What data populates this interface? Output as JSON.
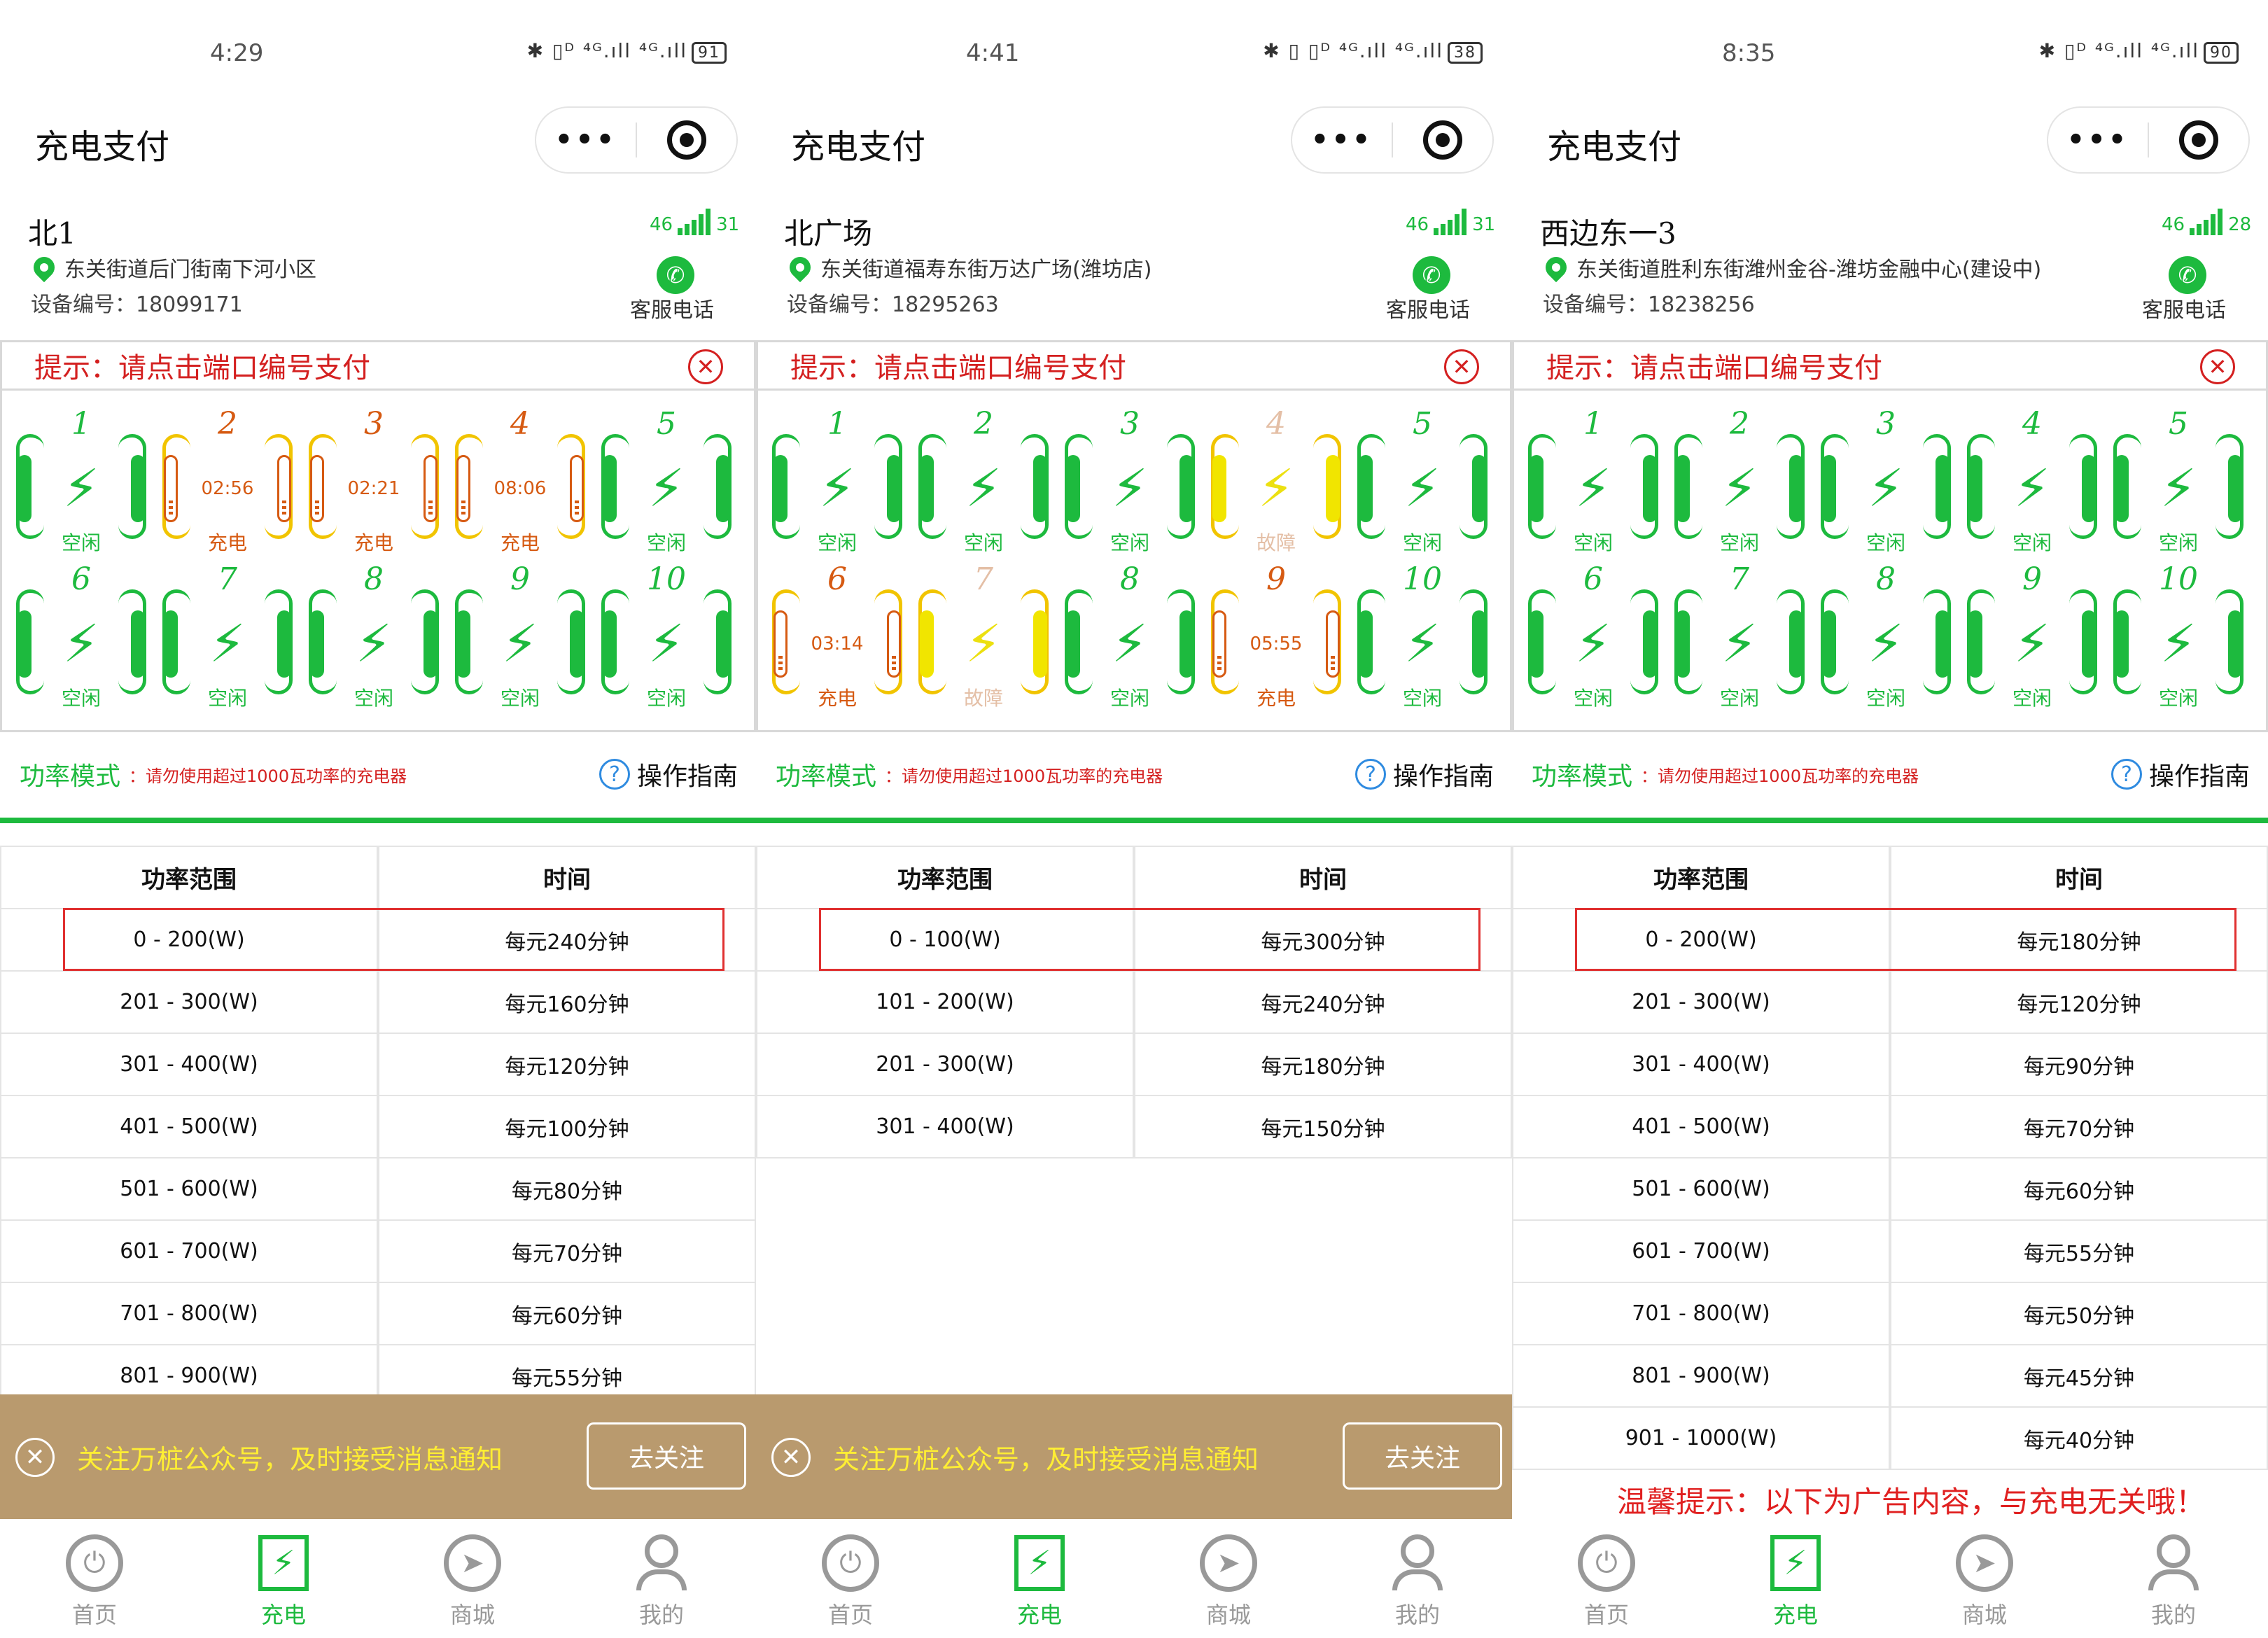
{
  "colors": {
    "accent": "#1dba3e",
    "hint": "#d42020",
    "charging": "#d65a12",
    "fault": "#f1e500",
    "follow_bar": "#b99a6e"
  },
  "icons": {
    "pin": "location-pin-icon",
    "phone": "phone-icon",
    "close": "close-circle-icon",
    "help": "question-circle-icon",
    "bolt": "lightning-bolt-icon"
  },
  "common": {
    "app_title": "充电支付",
    "capsule_more": "•••",
    "service": "客服电话",
    "hint": "提示：请点击端口编号支付",
    "power_label": "功率模式",
    "power_sub": "：请勿使用超过1000瓦功率的充电器",
    "guide": "操作指南",
    "col_range": "功率范围",
    "col_time": "时间",
    "follow_text": "关注万桩公众号，及时接受消息通知",
    "follow_btn": "去关注",
    "ad_note": "温馨提示：以下为广告内容，与充电无关哦！",
    "tabs": [
      "首页",
      "充电",
      "商城",
      "我的"
    ]
  },
  "panels": [
    {
      "status": {
        "time": "4:29",
        "net": "✱ ▯ᴰ ⁴ᴳ.ıll ⁴ᴳ.ıll",
        "battery": "91"
      },
      "station": {
        "name": "北1",
        "address": "东关街道后门街南下河小区",
        "device": "设备编号：18099171",
        "signal": "46",
        "signal_num": "31"
      },
      "ports": [
        {
          "n": "1",
          "state": "idle",
          "label": "空闲",
          "time": ""
        },
        {
          "n": "2",
          "state": "charging",
          "label": "充电",
          "time": "02:56"
        },
        {
          "n": "3",
          "state": "charging",
          "label": "充电",
          "time": "02:21"
        },
        {
          "n": "4",
          "state": "charging",
          "label": "充电",
          "time": "08:06"
        },
        {
          "n": "5",
          "state": "idle",
          "label": "空闲",
          "time": ""
        },
        {
          "n": "6",
          "state": "idle",
          "label": "空闲",
          "time": ""
        },
        {
          "n": "7",
          "state": "idle",
          "label": "空闲",
          "time": ""
        },
        {
          "n": "8",
          "state": "idle",
          "label": "空闲",
          "time": ""
        },
        {
          "n": "9",
          "state": "idle",
          "label": "空闲",
          "time": ""
        },
        {
          "n": "10",
          "state": "idle",
          "label": "空闲",
          "time": ""
        }
      ],
      "rates": [
        [
          "0 - 200(W)",
          "每元240分钟"
        ],
        [
          "201 - 300(W)",
          "每元160分钟"
        ],
        [
          "301 - 400(W)",
          "每元120分钟"
        ],
        [
          "401 - 500(W)",
          "每元100分钟"
        ],
        [
          "501 - 600(W)",
          "每元80分钟"
        ],
        [
          "601 - 700(W)",
          "每元70分钟"
        ],
        [
          "701 - 800(W)",
          "每元60分钟"
        ],
        [
          "801 - 900(W)",
          "每元55分钟"
        ]
      ],
      "follow": true,
      "ad": false
    },
    {
      "status": {
        "time": "4:41",
        "net": "✱ ▯ ▯ᴰ ⁴ᴳ.ıll ⁴ᴳ.ıll",
        "battery": "38"
      },
      "station": {
        "name": "北广场",
        "address": "东关街道福寿东街万达广场(潍坊店)",
        "device": "设备编号：18295263",
        "signal": "46",
        "signal_num": "31"
      },
      "ports": [
        {
          "n": "1",
          "state": "idle",
          "label": "空闲",
          "time": ""
        },
        {
          "n": "2",
          "state": "idle",
          "label": "空闲",
          "time": ""
        },
        {
          "n": "3",
          "state": "idle",
          "label": "空闲",
          "time": ""
        },
        {
          "n": "4",
          "state": "fault",
          "label": "故障",
          "time": ""
        },
        {
          "n": "5",
          "state": "idle",
          "label": "空闲",
          "time": ""
        },
        {
          "n": "6",
          "state": "charging",
          "label": "充电",
          "time": "03:14"
        },
        {
          "n": "7",
          "state": "fault",
          "label": "故障",
          "time": ""
        },
        {
          "n": "8",
          "state": "idle",
          "label": "空闲",
          "time": ""
        },
        {
          "n": "9",
          "state": "charging",
          "label": "充电",
          "time": "05:55"
        },
        {
          "n": "10",
          "state": "idle",
          "label": "空闲",
          "time": ""
        }
      ],
      "rates": [
        [
          "0 - 100(W)",
          "每元300分钟"
        ],
        [
          "101 - 200(W)",
          "每元240分钟"
        ],
        [
          "201 - 300(W)",
          "每元180分钟"
        ],
        [
          "301 - 400(W)",
          "每元150分钟"
        ]
      ],
      "follow": true,
      "ad": false
    },
    {
      "status": {
        "time": "8:35",
        "net": "✱ ▯ᴰ ⁴ᴳ.ıll ⁴ᴳ.ıll",
        "battery": "90"
      },
      "station": {
        "name": "西边东一3",
        "address": "东关街道胜利东街潍州金谷-潍坊金融中心(建设中)",
        "device": "设备编号：18238256",
        "signal": "46",
        "signal_num": "28"
      },
      "ports": [
        {
          "n": "1",
          "state": "idle",
          "label": "空闲",
          "time": ""
        },
        {
          "n": "2",
          "state": "idle",
          "label": "空闲",
          "time": ""
        },
        {
          "n": "3",
          "state": "idle",
          "label": "空闲",
          "time": ""
        },
        {
          "n": "4",
          "state": "idle",
          "label": "空闲",
          "time": ""
        },
        {
          "n": "5",
          "state": "idle",
          "label": "空闲",
          "time": ""
        },
        {
          "n": "6",
          "state": "idle",
          "label": "空闲",
          "time": ""
        },
        {
          "n": "7",
          "state": "idle",
          "label": "空闲",
          "time": ""
        },
        {
          "n": "8",
          "state": "idle",
          "label": "空闲",
          "time": ""
        },
        {
          "n": "9",
          "state": "idle",
          "label": "空闲",
          "time": ""
        },
        {
          "n": "10",
          "state": "idle",
          "label": "空闲",
          "time": ""
        }
      ],
      "rates": [
        [
          "0 - 200(W)",
          "每元180分钟"
        ],
        [
          "201 - 300(W)",
          "每元120分钟"
        ],
        [
          "301 - 400(W)",
          "每元90分钟"
        ],
        [
          "401 - 500(W)",
          "每元70分钟"
        ],
        [
          "501 - 600(W)",
          "每元60分钟"
        ],
        [
          "601 - 700(W)",
          "每元55分钟"
        ],
        [
          "701 - 800(W)",
          "每元50分钟"
        ],
        [
          "801 - 900(W)",
          "每元45分钟"
        ],
        [
          "901 - 1000(W)",
          "每元40分钟"
        ]
      ],
      "follow": false,
      "ad": true
    }
  ]
}
